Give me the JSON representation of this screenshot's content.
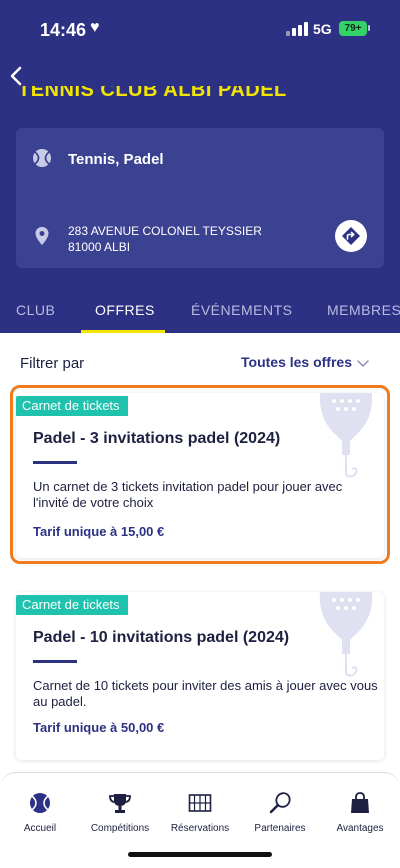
{
  "status_bar": {
    "time": "14:46",
    "network": "5G",
    "battery": "79+"
  },
  "club": {
    "name": "TENNIS CLUB ALBI PADEL",
    "sports": "Tennis, Padel",
    "address_line1": "283 AVENUE COLONEL TEYSSIER",
    "address_line2": "81000 ALBI"
  },
  "tabs": [
    {
      "label": "CLUB"
    },
    {
      "label": "OFFRES"
    },
    {
      "label": "ÉVÉNEMENTS"
    },
    {
      "label": "MEMBRES"
    }
  ],
  "active_tab": "OFFRES",
  "filter": {
    "label": "Filtrer par",
    "value": "Toutes les offres"
  },
  "offers": [
    {
      "badge": "Carnet de tickets",
      "title": "Padel - 3 invitations padel (2024)",
      "description": "Un carnet de 3 tickets invitation padel pour jouer avec l'invité de votre choix",
      "price": "Tarif unique à 15,00 €"
    },
    {
      "badge": "Carnet de tickets",
      "title": "Padel - 10 invitations padel (2024)",
      "description": "Carnet de 10 tickets pour inviter des amis à jouer avec vous au padel.",
      "price": "Tarif unique à 50,00 €"
    }
  ],
  "bottom_nav": [
    {
      "label": "Accueil"
    },
    {
      "label": "Compétitions"
    },
    {
      "label": "Réservations"
    },
    {
      "label": "Partenaires"
    },
    {
      "label": "Avantages"
    }
  ],
  "colors": {
    "primary": "#2c3184",
    "accent_yellow": "#f2e600",
    "badge_teal": "#1fc3ad",
    "highlight_orange": "#f07a1e"
  }
}
